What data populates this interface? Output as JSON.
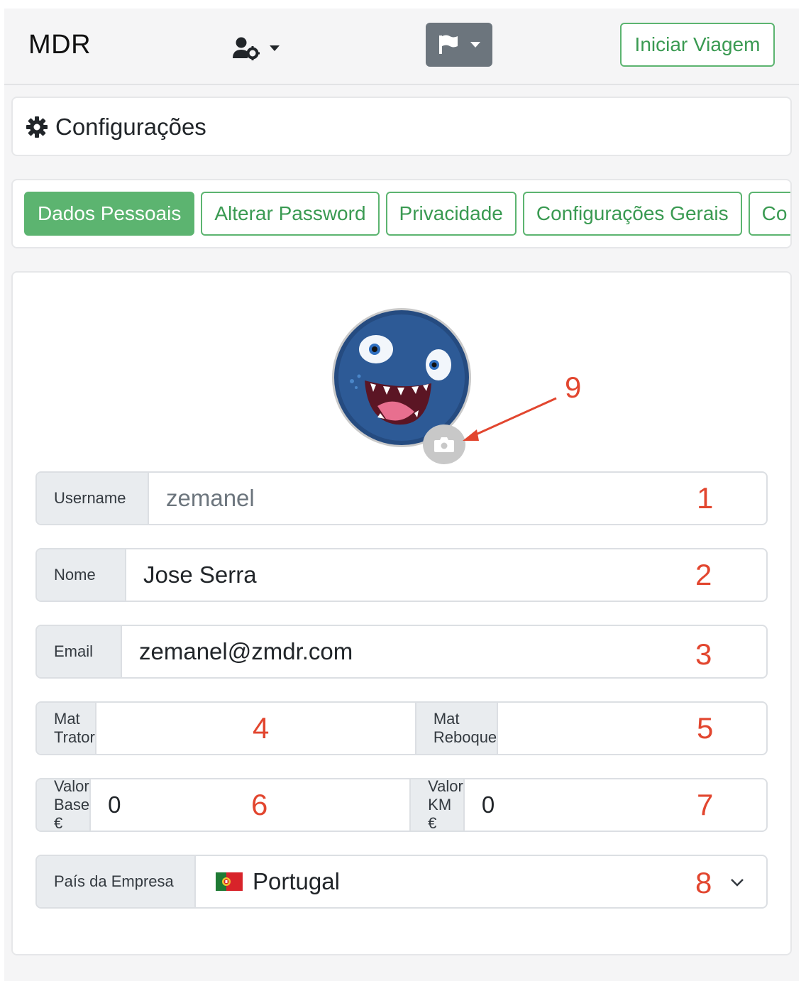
{
  "navbar": {
    "brand": "MDR",
    "start_button": "Iniciar Viagem"
  },
  "config": {
    "title": "Configurações"
  },
  "tabs": [
    {
      "label": "Dados Pessoais",
      "active": true
    },
    {
      "label": "Alterar Password",
      "active": false
    },
    {
      "label": "Privacidade",
      "active": false
    },
    {
      "label": "Configurações Gerais",
      "active": false
    },
    {
      "label": "Co",
      "active": false
    }
  ],
  "form": {
    "username": {
      "label": "Username",
      "value": "zemanel"
    },
    "nome": {
      "label": "Nome",
      "value": "Jose Serra"
    },
    "email": {
      "label": "Email",
      "value": "zemanel@zmdr.com"
    },
    "mat_trator": {
      "label": "Mat Trator",
      "value": ""
    },
    "mat_reboque": {
      "label": "Mat Reboque",
      "value": ""
    },
    "valor_base": {
      "label": "Valor Base €",
      "value": "0"
    },
    "valor_km": {
      "label": "Valor KM €",
      "value": "0"
    },
    "pais": {
      "label": "País da Empresa",
      "value": "Portugal"
    }
  },
  "annotations": [
    "1",
    "2",
    "3",
    "4",
    "5",
    "6",
    "7",
    "8",
    "9"
  ],
  "colors": {
    "accent_green": "#5cb470",
    "annotation_red": "#e2462f",
    "flag_button_gray": "#6c757d"
  },
  "icons": {
    "user_settings": "user-cog-icon",
    "flag": "flag-icon",
    "settings": "gear-icon",
    "camera": "camera-icon",
    "portugal_flag": "portugal-flag-icon",
    "select_chevron": "chevron-down-icon"
  }
}
